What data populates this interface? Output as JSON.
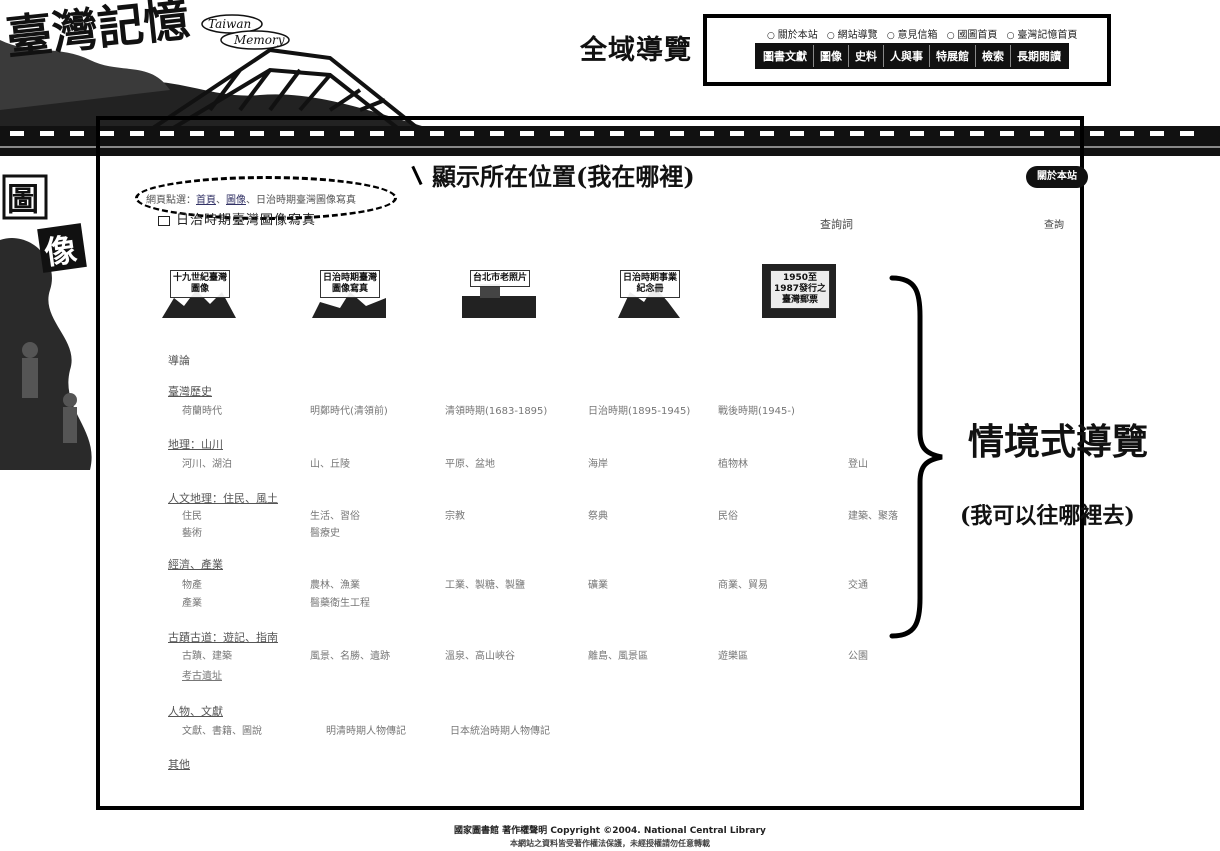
{
  "logo": {
    "chinese": "臺灣記憶",
    "en_line1": "Taiwan",
    "en_line2": "Memory"
  },
  "side_logo": "圖像",
  "global_nav": {
    "label": "全域導覽",
    "top_links": [
      "關於本站",
      "網站導覽",
      "意見信箱",
      "國圖首頁",
      "臺灣記憶首頁"
    ],
    "tabs": [
      "圖書文獻",
      "圖像",
      "史料",
      "人與事",
      "特展館",
      "檢索",
      "長期閱讀"
    ]
  },
  "breadcrumb": {
    "prefix": "網頁點選：",
    "home": "首頁",
    "sep": "、",
    "images": "圖像",
    "current": "日治時期臺灣圖像寫真"
  },
  "location_label": "顯示所在位置(我在哪裡)",
  "about_button": "關於本站",
  "page_title": "日治時期臺灣圖像寫真",
  "query_label": "查詢詞",
  "query_button": "查詢",
  "themes": [
    {
      "label": "十九世紀臺灣圖像"
    },
    {
      "label": "日治時期臺灣圖像寫真"
    },
    {
      "label": "台北市老照片"
    },
    {
      "label": "日治時期事業紀念冊"
    },
    {
      "label": "1950至1987發行之臺灣郵票"
    }
  ],
  "categories": [
    {
      "title": "導論",
      "items": []
    },
    {
      "title": "臺灣歷史",
      "items": [
        "荷蘭時代",
        "明鄭時代(清領前)",
        "清領時期(1683-1895)",
        "日治時期(1895-1945)",
        "戰後時期(1945-)"
      ]
    },
    {
      "title": "地理：山川",
      "items": [
        "河川、湖泊",
        "山、丘陵",
        "平原、盆地",
        "海岸",
        "植物林",
        "登山"
      ]
    },
    {
      "title": "人文地理：住民、風土",
      "items": [
        "住民",
        "生活、習俗",
        "宗教",
        "祭典",
        "民俗",
        "建築、聚落",
        "藝術",
        "醫療史"
      ]
    },
    {
      "title": "經濟、產業",
      "items": [
        "物產",
        "農林、漁業",
        "工業、製糖、製鹽",
        "礦業",
        "商業、貿易",
        "交通",
        "產業",
        "醫藥衛生工程"
      ]
    },
    {
      "title": "古蹟古道：遊記、指南",
      "items": [
        "古蹟、建築",
        "風景、名勝、遺跡",
        "溫泉、高山峽谷",
        "離島、風景區",
        "遊樂區",
        "公園",
        "考古遺址"
      ]
    },
    {
      "title": "人物、文獻",
      "items": [
        "文獻、書籍、圖說",
        "明清時期人物傳記",
        "日本統治時期人物傳記"
      ]
    },
    {
      "title": "其他",
      "items": []
    }
  ],
  "nav_label": "情境式導覽",
  "nav_sub": "(我可以往哪裡去)",
  "footer": {
    "line1": "國家圖書館 著作權聲明 Copyright ©2004. National Central Library",
    "line2": "本網站之資料皆受著作權法保護，未經授權請勿任意轉載"
  }
}
